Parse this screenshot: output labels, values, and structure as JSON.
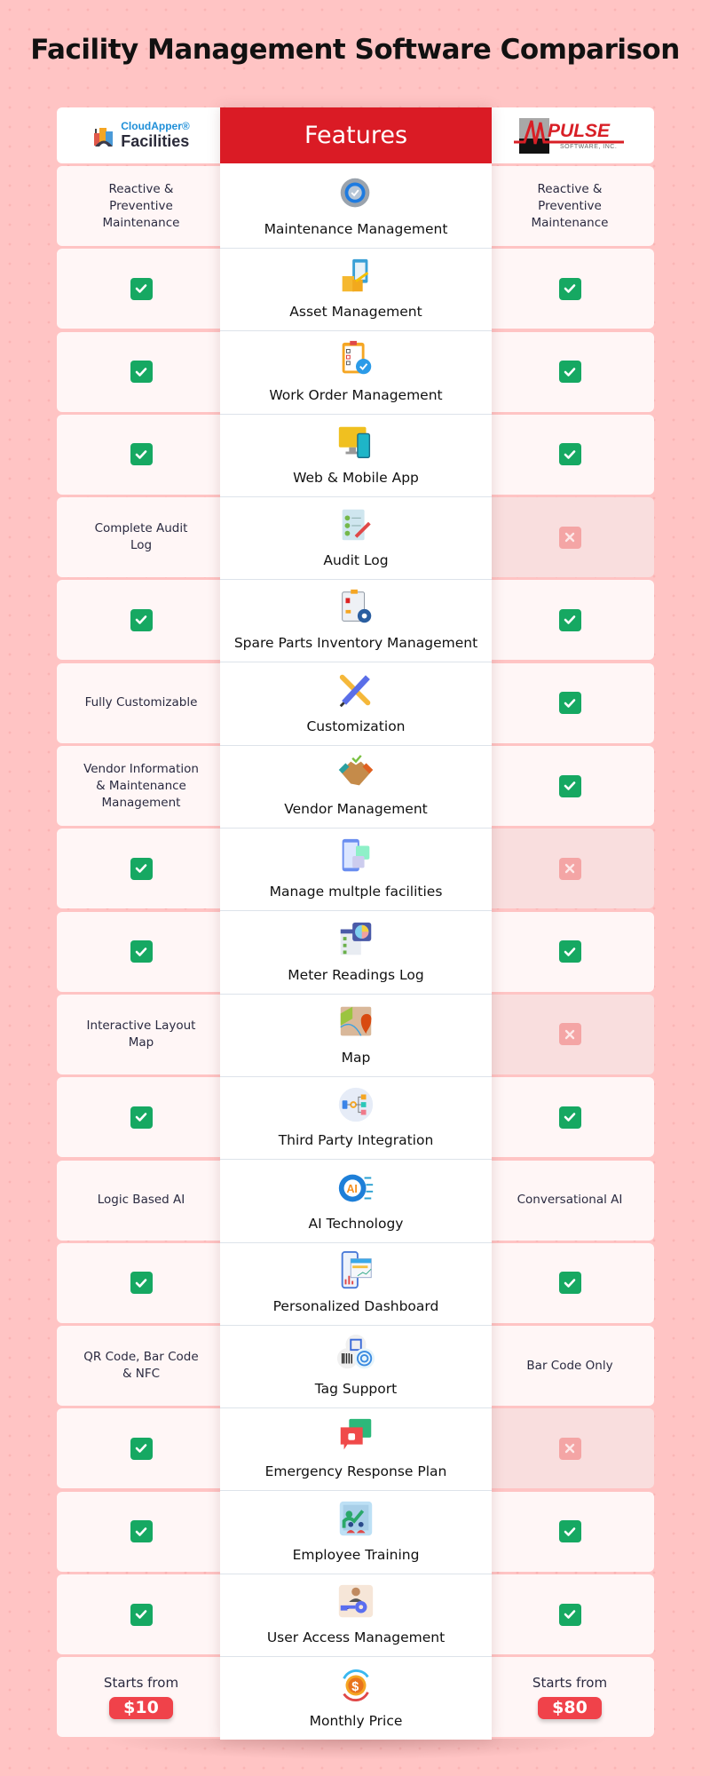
{
  "title": "Facility Management Software Comparison",
  "header": {
    "left_product": {
      "brand": "CloudApper®",
      "name": "Facilities",
      "logo_icon": "building-logo-icon"
    },
    "features_label": "Features",
    "right_product": {
      "brand": "PULSE",
      "subtitle": "SOFTWARE, INC.",
      "logo_icon": "m-pulse-logo-icon"
    }
  },
  "colors": {
    "accent_red": "#da1b25",
    "check_green": "#16a862",
    "cross_pink": "#f4a5a5",
    "price_red": "#f0424a",
    "background": "#ffc4c4"
  },
  "rows": [
    {
      "feature": "Maintenance Management",
      "icon": "gear-check-icon",
      "left": {
        "type": "text",
        "text": "Reactive & Preventive Maintenance"
      },
      "right": {
        "type": "text",
        "text": "Reactive & Preventive Maintenance"
      }
    },
    {
      "feature": "Asset Management",
      "icon": "clipboard-boxes-icon",
      "left": {
        "type": "check"
      },
      "right": {
        "type": "check"
      }
    },
    {
      "feature": "Work Order Management",
      "icon": "checklist-clipboard-icon",
      "left": {
        "type": "check"
      },
      "right": {
        "type": "check"
      }
    },
    {
      "feature": "Web & Mobile App",
      "icon": "monitor-phone-icon",
      "left": {
        "type": "check"
      },
      "right": {
        "type": "check"
      }
    },
    {
      "feature": "Audit Log",
      "icon": "notepad-pencil-icon",
      "left": {
        "type": "text",
        "text": "Complete Audit Log"
      },
      "right": {
        "type": "cross"
      }
    },
    {
      "feature": "Spare Parts Inventory Management",
      "icon": "inventory-gear-icon",
      "left": {
        "type": "check"
      },
      "right": {
        "type": "check"
      }
    },
    {
      "feature": "Customization",
      "icon": "wrench-pencil-icon",
      "left": {
        "type": "text",
        "text": "Fully Customizable"
      },
      "right": {
        "type": "check"
      }
    },
    {
      "feature": "Vendor Management",
      "icon": "handshake-icon",
      "left": {
        "type": "text",
        "text": "Vendor Information & Maintenance Management"
      },
      "right": {
        "type": "check"
      }
    },
    {
      "feature": "Manage multple facilities",
      "icon": "multi-device-icon",
      "left": {
        "type": "check"
      },
      "right": {
        "type": "cross"
      }
    },
    {
      "feature": "Meter Readings Log",
      "icon": "pie-chart-list-icon",
      "left": {
        "type": "check"
      },
      "right": {
        "type": "check"
      }
    },
    {
      "feature": "Map",
      "icon": "map-pin-icon",
      "left": {
        "type": "text",
        "text": "Interactive Layout Map"
      },
      "right": {
        "type": "cross"
      }
    },
    {
      "feature": "Third Party Integration",
      "icon": "flow-diagram-icon",
      "left": {
        "type": "check"
      },
      "right": {
        "type": "check"
      }
    },
    {
      "feature": "AI Technology",
      "icon": "ai-gear-icon",
      "left": {
        "type": "text",
        "text": "Logic Based AI"
      },
      "right": {
        "type": "text",
        "text": "Conversational AI"
      }
    },
    {
      "feature": "Personalized Dashboard",
      "icon": "phone-dashboard-icon",
      "left": {
        "type": "check"
      },
      "right": {
        "type": "check"
      }
    },
    {
      "feature": "Tag Support",
      "icon": "qr-barcode-nfc-icon",
      "left": {
        "type": "text",
        "text": "QR Code, Bar Code & NFC"
      },
      "right": {
        "type": "text",
        "text": "Bar Code Only"
      }
    },
    {
      "feature": "Emergency Response Plan",
      "icon": "alarm-chat-icon",
      "left": {
        "type": "check"
      },
      "right": {
        "type": "cross"
      }
    },
    {
      "feature": "Employee Training",
      "icon": "training-board-icon",
      "left": {
        "type": "check"
      },
      "right": {
        "type": "check"
      }
    },
    {
      "feature": "User Access Management",
      "icon": "user-key-icon",
      "left": {
        "type": "check"
      },
      "right": {
        "type": "check"
      }
    },
    {
      "feature": "Monthly Price",
      "icon": "dollar-coin-cycle-icon",
      "left": {
        "type": "price",
        "prefix": "Starts from",
        "price": "$10"
      },
      "right": {
        "type": "price",
        "prefix": "Starts from",
        "price": "$80"
      }
    }
  ]
}
